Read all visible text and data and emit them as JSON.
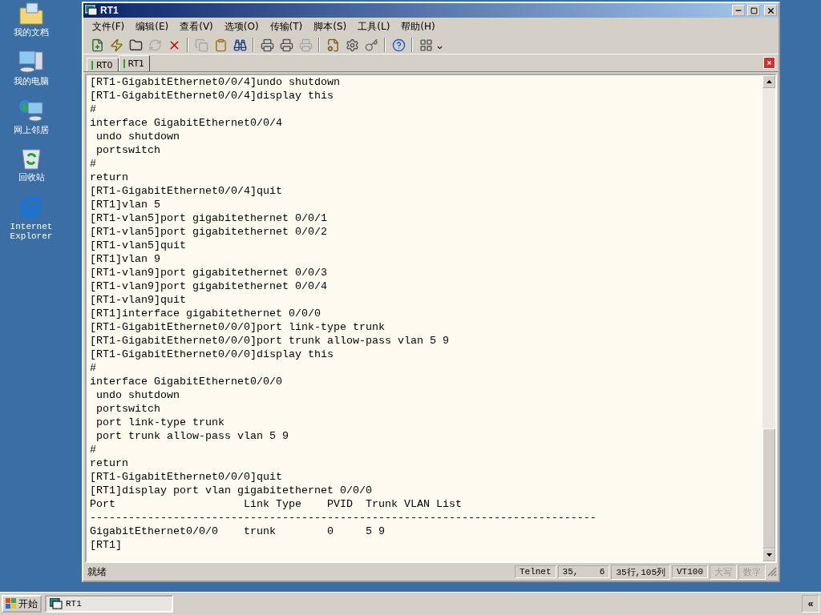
{
  "desktop_icons": [
    {
      "kind": "documents",
      "label": "我的文档"
    },
    {
      "kind": "computer",
      "label": "我的电脑"
    },
    {
      "kind": "network",
      "label": "网上邻居"
    },
    {
      "kind": "recycle",
      "label": "回收站"
    },
    {
      "kind": "browser",
      "label": "Internet Explorer"
    }
  ],
  "window": {
    "title": "RT1"
  },
  "menu": [
    "文件(F)",
    "编辑(E)",
    "查看(V)",
    "选项(O)",
    "传输(T)",
    "脚本(S)",
    "工具(L)",
    "帮助(H)"
  ],
  "toolbar": [
    [
      {
        "kind": "connect",
        "disabled": false
      },
      {
        "kind": "quick",
        "disabled": false
      },
      {
        "kind": "folder",
        "disabled": false
      },
      {
        "kind": "reconnect",
        "disabled": true
      },
      {
        "kind": "disconnect",
        "disabled": false
      }
    ],
    [
      {
        "kind": "copy",
        "disabled": true
      },
      {
        "kind": "paste",
        "disabled": false
      },
      {
        "kind": "find",
        "disabled": false
      }
    ],
    [
      {
        "kind": "print",
        "disabled": false
      },
      {
        "kind": "print",
        "disabled": false
      },
      {
        "kind": "printer",
        "disabled": true
      }
    ],
    [
      {
        "kind": "options",
        "disabled": false
      },
      {
        "kind": "settings",
        "disabled": false
      },
      {
        "kind": "key",
        "disabled": false
      }
    ],
    [
      {
        "kind": "help",
        "disabled": false
      }
    ],
    [
      {
        "kind": "grid",
        "disabled": false
      }
    ]
  ],
  "tabs": [
    {
      "label": "RT0",
      "selected": false
    },
    {
      "label": "RT1",
      "selected": true
    }
  ],
  "terminal_lines": [
    "[RT1-GigabitEthernet0/0/4]undo shutdown",
    "[RT1-GigabitEthernet0/0/4]display this",
    "#",
    "interface GigabitEthernet0/0/4",
    " undo shutdown",
    " portswitch",
    "#",
    "return",
    "[RT1-GigabitEthernet0/0/4]quit",
    "[RT1]vlan 5",
    "[RT1-vlan5]port gigabitethernet 0/0/1",
    "[RT1-vlan5]port gigabitethernet 0/0/2",
    "[RT1-vlan5]quit",
    "[RT1]vlan 9",
    "[RT1-vlan9]port gigabitethernet 0/0/3",
    "[RT1-vlan9]port gigabitethernet 0/0/4",
    "[RT1-vlan9]quit",
    "[RT1]interface gigabitethernet 0/0/0",
    "[RT1-GigabitEthernet0/0/0]port link-type trunk",
    "[RT1-GigabitEthernet0/0/0]port trunk allow-pass vlan 5 9",
    "[RT1-GigabitEthernet0/0/0]display this",
    "#",
    "interface GigabitEthernet0/0/0",
    " undo shutdown",
    " portswitch",
    " port link-type trunk",
    " port trunk allow-pass vlan 5 9",
    "#",
    "return",
    "[RT1-GigabitEthernet0/0/0]quit",
    "[RT1]display port vlan gigabitethernet 0/0/0",
    "Port                    Link Type    PVID  Trunk VLAN List",
    "-------------------------------------------------------------------------------",
    "GigabitEthernet0/0/0    trunk        0     5 9",
    "[RT1]"
  ],
  "status_bar": {
    "message": "就绪",
    "panes": [
      {
        "text": "Telnet",
        "disabled": false
      },
      {
        "text": "35,    6",
        "disabled": false
      },
      {
        "text": "35行,105列",
        "disabled": false
      },
      {
        "text": "VT100",
        "disabled": false
      },
      {
        "text": "大写",
        "disabled": true
      },
      {
        "text": "数字",
        "disabled": true
      }
    ]
  },
  "taskbar": {
    "start": "开始",
    "tasks": [
      {
        "label": "RT1",
        "selected": true
      }
    ],
    "tray_toggle": "«"
  }
}
